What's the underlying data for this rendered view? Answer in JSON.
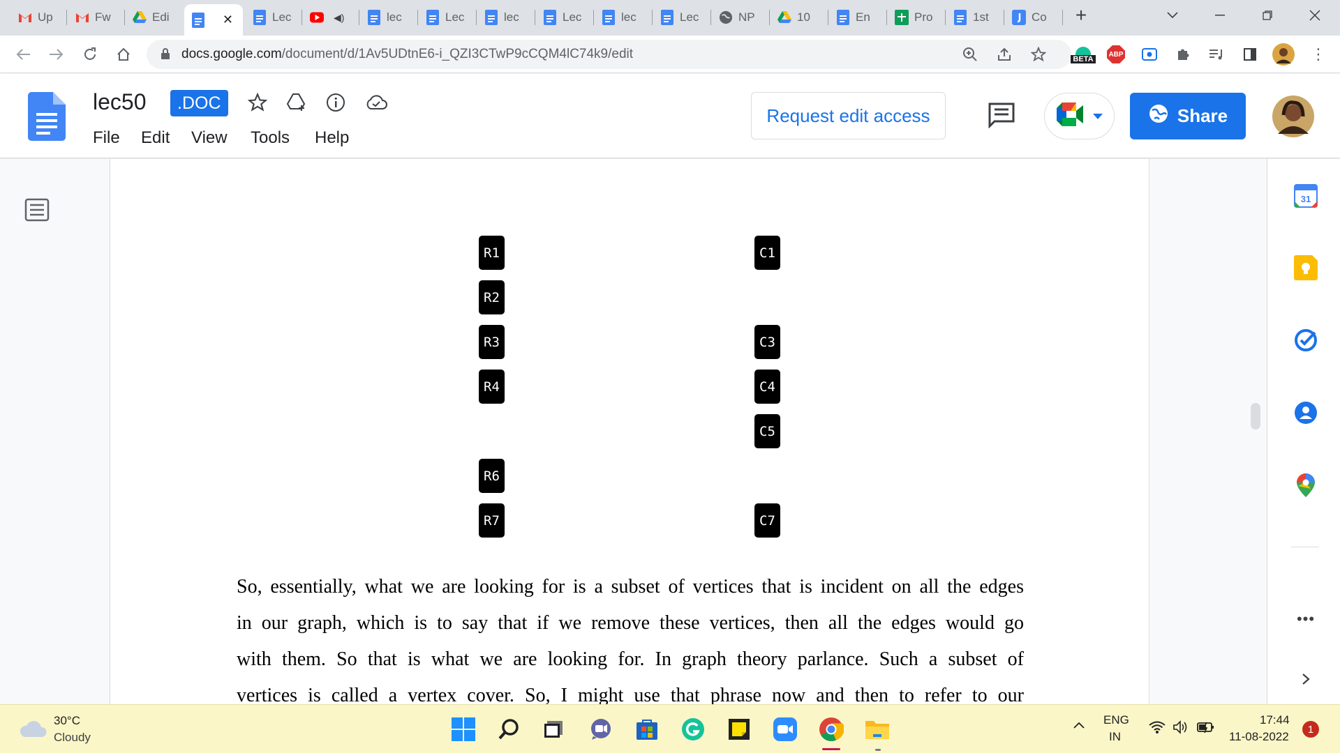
{
  "browser": {
    "tabs": [
      {
        "title": "Up",
        "icon": "gmail-icon"
      },
      {
        "title": "Fw",
        "icon": "gmail-icon"
      },
      {
        "title": "Edi",
        "icon": "google-drive-icon"
      },
      {
        "title": "",
        "icon": "google-docs-icon",
        "active": true
      },
      {
        "title": "Lec",
        "icon": "google-docs-icon"
      },
      {
        "title": "",
        "icon": "youtube-icon"
      },
      {
        "title": "lec",
        "icon": "google-docs-icon"
      },
      {
        "title": "Lec",
        "icon": "google-docs-icon"
      },
      {
        "title": "lec",
        "icon": "google-docs-icon"
      },
      {
        "title": "Lec",
        "icon": "google-docs-icon"
      },
      {
        "title": "lec",
        "icon": "google-docs-icon"
      },
      {
        "title": "Lec",
        "icon": "google-docs-icon"
      },
      {
        "title": "NP",
        "icon": "globe-icon"
      },
      {
        "title": "10",
        "icon": "google-drive-icon"
      },
      {
        "title": "En",
        "icon": "google-docs-icon"
      },
      {
        "title": "Pro",
        "icon": "google-sheets-icon"
      },
      {
        "title": "1st",
        "icon": "google-docs-icon"
      },
      {
        "title": "Co",
        "icon": "jamboard-icon"
      }
    ],
    "url_domain": "docs.google.com",
    "url_path": "/document/d/1Av5UDtnE6-i_QZI3CTwP9cCQM4lC74k9/edit",
    "grammarly_badge": "BETA",
    "abp_badge": "ABP"
  },
  "docs": {
    "title": "lec50",
    "badge": ".DOC",
    "menu": [
      "File",
      "Edit",
      "View",
      "Tools",
      "Help"
    ],
    "request_edit": "Request edit access",
    "share": "Share"
  },
  "graph": {
    "rows": [
      "R1",
      "R2",
      "R3",
      "R4",
      "R6",
      "R7"
    ],
    "cols": [
      "C1",
      "C3",
      "C4",
      "C5",
      "C7"
    ]
  },
  "document": {
    "lines": [
      "So, essentially, what we are looking for is a subset of vertices that is incident on all the edges",
      "in our graph, which is to say that if we remove these vertices, then all the edges would go",
      "with them. So that is what we are looking for. In graph theory parlance. Such a subset of",
      "vertices is called a vertex cover. So, I might use that phrase now and then to refer to our"
    ]
  },
  "side_panel": {
    "calendar_day": "31"
  },
  "taskbar": {
    "temperature": "30°C",
    "weather": "Cloudy",
    "lang_top": "ENG",
    "lang_bottom": "IN",
    "time": "17:44",
    "date": "11-08-2022",
    "notifications": "1"
  },
  "colors": {
    "accent": "#1a73e8",
    "taskbar": "#fbf6c7",
    "tabstrip": "#dee1e6"
  }
}
